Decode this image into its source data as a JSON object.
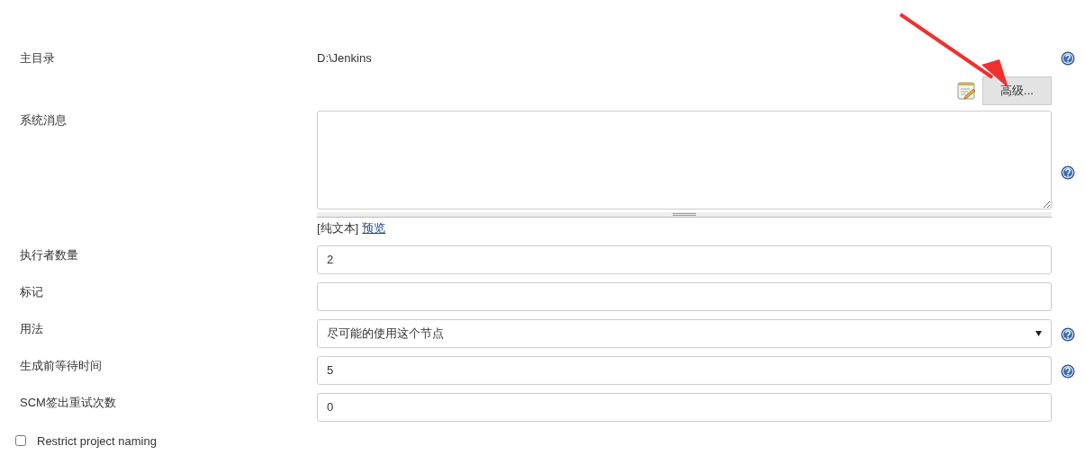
{
  "home_dir": {
    "label": "主目录",
    "value": "D:\\Jenkins",
    "help": true
  },
  "advanced_button": {
    "label": "高级..."
  },
  "system_message": {
    "label": "系统消息",
    "help": true,
    "format_text": "[纯文本]",
    "preview_link": "预览"
  },
  "fields": [
    {
      "kind": "input",
      "label": "执行者数量",
      "value": "2",
      "help": false
    },
    {
      "kind": "input",
      "label": "标记",
      "help": false
    },
    {
      "kind": "select",
      "label": "用法",
      "value": "尽可能的使用这个节点",
      "help": true
    },
    {
      "kind": "input",
      "label": "生成前等待时间",
      "value": "5",
      "help": true
    },
    {
      "kind": "input",
      "label": "SCM签出重试次数",
      "value": "0",
      "help": false
    }
  ],
  "restrict_naming": {
    "label": "Restrict project naming",
    "checked": false
  }
}
